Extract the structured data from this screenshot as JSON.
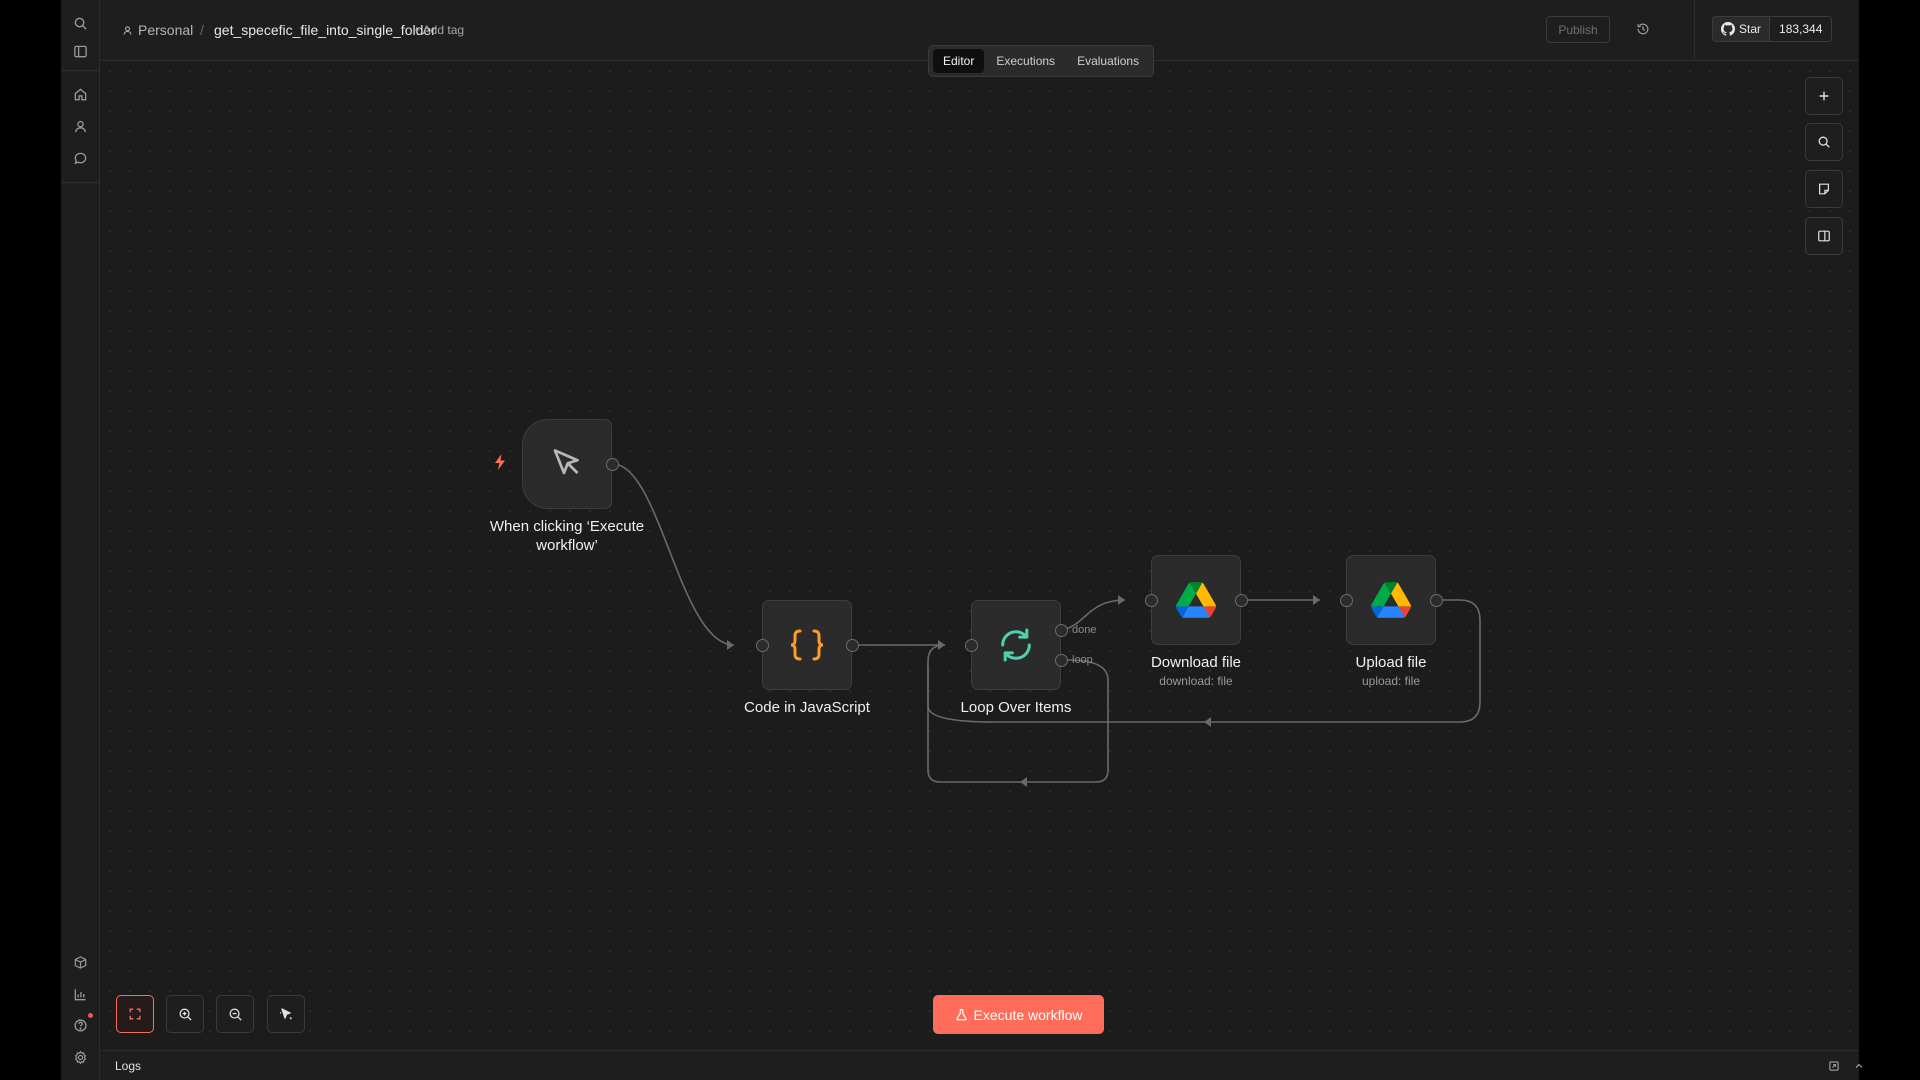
{
  "header": {
    "project": "Personal",
    "separator": "/",
    "workflow_name": "get_specefic_file_into_single_folder",
    "add_tag": "+ Add tag",
    "publish_label": "Publish",
    "github_star_label": "Star",
    "github_star_count": "183,344"
  },
  "tabs": [
    {
      "label": "Editor",
      "active": true
    },
    {
      "label": "Executions",
      "active": false
    },
    {
      "label": "Evaluations",
      "active": false
    }
  ],
  "sidebar": {
    "top_icons": [
      "search-icon",
      "panel-toggle-icon"
    ],
    "nav_icons": [
      "home-icon",
      "user-icon",
      "chat-icon"
    ],
    "bottom_icons": [
      "templates-icon",
      "insights-icon",
      "help-icon",
      "settings-icon"
    ]
  },
  "nodes": {
    "trigger": {
      "label": "When clicking ‘Execute workflow’",
      "icon": "cursor-icon"
    },
    "code": {
      "label": "Code in JavaScript",
      "icon": "curly-braces-icon"
    },
    "loop": {
      "label": "Loop Over Items",
      "icon": "loop-icon",
      "output_done": "done",
      "output_loop": "loop"
    },
    "download": {
      "label": "Download file",
      "subtitle": "download: file",
      "icon": "google-drive-icon"
    },
    "upload": {
      "label": "Upload file",
      "subtitle": "upload: file",
      "icon": "google-drive-icon"
    }
  },
  "canvas_tools": [
    "add-node-icon",
    "search-icon",
    "sticky-note-icon",
    "side-panel-icon"
  ],
  "zoom_tools": [
    "fit-view-icon",
    "zoom-in-icon",
    "zoom-out-icon",
    "tidy-up-icon"
  ],
  "execute_button": "Execute workflow",
  "logs": {
    "title": "Logs"
  },
  "colors": {
    "accent": "#ff6d5a",
    "code_icon": "#ff9b26",
    "loop_icon": "#4fd1b0"
  }
}
